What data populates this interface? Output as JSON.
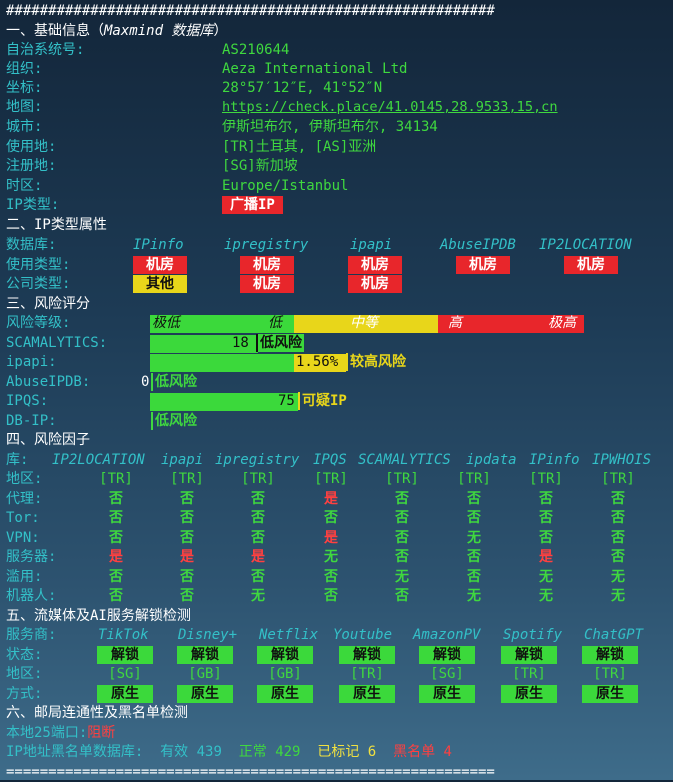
{
  "separator_top": "##########################################################",
  "separator_bottom": "==========================================================",
  "section1": {
    "title": "一、基础信息（",
    "title_db": "Maxmind 数据库",
    "title_end": "）",
    "rows": [
      {
        "label": "自治系统号:",
        "value": "AS210644"
      },
      {
        "label": "组织:",
        "value": "Aeza International Ltd"
      },
      {
        "label": "坐标:",
        "value": "28°57′12″E, 41°52″N"
      },
      {
        "label": "地图:",
        "value": "https://check.place/41.0145,28.9533,15,cn"
      },
      {
        "label": "城市:",
        "value": "伊斯坦布尔, 伊斯坦布尔, 34134"
      },
      {
        "label": "使用地:",
        "value": "[TR]土耳其, [AS]亚洲"
      },
      {
        "label": "注册地:",
        "value": "[SG]新加坡"
      },
      {
        "label": "时区:",
        "value": "Europe/Istanbul"
      },
      {
        "label": "IP类型:",
        "value": "广播IP"
      }
    ]
  },
  "section2": {
    "title": "二、IP类型属性",
    "db_label": "数据库:",
    "dbs": [
      "IPinfo",
      "ipregistry",
      "ipapi",
      "AbuseIPDB",
      "IP2LOCATION"
    ],
    "usage_label": "使用类型:",
    "usage": [
      "机房",
      "机房",
      "机房",
      "机房",
      "机房"
    ],
    "company_label": "公司类型:",
    "company": [
      "其他",
      "机房",
      "机房"
    ]
  },
  "section3": {
    "title": "三、风险评分",
    "level_label": "风险等级:",
    "levels": [
      "极低",
      "低",
      "中等",
      "高",
      "极高"
    ],
    "scores": [
      {
        "label": "SCAMALYTICS:",
        "score": "18",
        "text": "低风险",
        "fraction": 0.18
      },
      {
        "label": "ipapi:",
        "score": "1.56%",
        "text": "较高风险",
        "fraction": 0.3
      },
      {
        "label": "AbuseIPDB:",
        "score": "0",
        "text": "低风险",
        "fraction": 0
      },
      {
        "label": "IPQS:",
        "score": "75",
        "text": "可疑IP",
        "fraction": 0.34
      },
      {
        "label": "DB-IP:",
        "score": "",
        "text": "低风险",
        "fraction": 0
      }
    ]
  },
  "section4": {
    "title": "四、风险因子",
    "lib_label": "库:",
    "libs": [
      "IP2LOCATION",
      "ipapi",
      "ipregistry",
      "IPQS",
      "SCAMALYTICS",
      "ipdata",
      "IPinfo",
      "IPWHOIS"
    ],
    "rows": [
      {
        "label": "地区:",
        "values": [
          "[TR]",
          "[TR]",
          "[TR]",
          "[TR]",
          "[TR]",
          "[TR]",
          "[TR]",
          "[TR]"
        ]
      },
      {
        "label": "代理:",
        "values": [
          "否",
          "否",
          "否",
          "是",
          "否",
          "否",
          "否",
          "否"
        ]
      },
      {
        "label": "Tor:",
        "values": [
          "否",
          "否",
          "否",
          "否",
          "否",
          "否",
          "否",
          "否"
        ]
      },
      {
        "label": "VPN:",
        "values": [
          "否",
          "否",
          "否",
          "是",
          "否",
          "无",
          "否",
          "否"
        ]
      },
      {
        "label": "服务器:",
        "values": [
          "是",
          "是",
          "是",
          "无",
          "否",
          "否",
          "是",
          "否"
        ]
      },
      {
        "label": "滥用:",
        "values": [
          "否",
          "否",
          "否",
          "否",
          "无",
          "否",
          "无",
          "无"
        ]
      },
      {
        "label": "机器人:",
        "values": [
          "否",
          "否",
          "无",
          "否",
          "否",
          "无",
          "无",
          "无"
        ]
      }
    ]
  },
  "section5": {
    "title": "五、流媒体及AI服务解锁检测",
    "svc_label": "服务商:",
    "services": [
      "TikTok",
      "Disney+",
      "Netflix",
      "Youtube",
      "AmazonPV",
      "Spotify",
      "ChatGPT"
    ],
    "status_label": "状态:",
    "status": [
      "解锁",
      "解锁",
      "解锁",
      "解锁",
      "解锁",
      "解锁",
      "解锁"
    ],
    "region_label": "地区:",
    "regions": [
      "[SG]",
      "[GB]",
      "[GB]",
      "[TR]",
      "[SG]",
      "[TR]",
      "[TR]"
    ],
    "method_label": "方式:",
    "methods": [
      "原生",
      "原生",
      "原生",
      "原生",
      "原生",
      "原生",
      "原生"
    ]
  },
  "section6": {
    "title": "六、邮局连通性及黑名单检测",
    "port_label": "本地25端口:",
    "port_value": "阻断",
    "bl_label": "IP地址黑名单数据库:",
    "valid_label": "有效",
    "valid_value": "439",
    "normal_label": "正常",
    "normal_value": "429",
    "marked_label": "已标记",
    "marked_value": "6",
    "black_label": "黑名单",
    "black_value": "4"
  },
  "colors": {
    "green": "#3fd83f",
    "cyan": "#33c0c8",
    "red": "#e8262b",
    "yellow": "#e8d61a"
  }
}
